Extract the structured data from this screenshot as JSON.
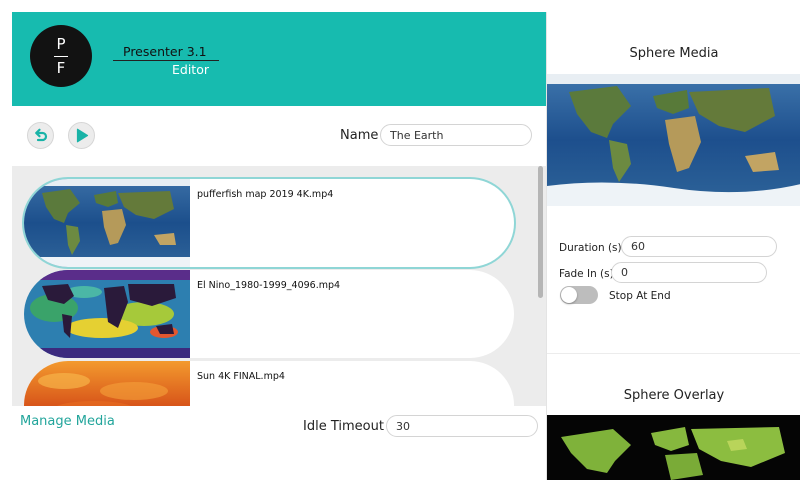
{
  "header": {
    "logo_top": "P",
    "logo_bottom": "F",
    "app_title": "Presenter 3.1",
    "app_subtitle": "Editor",
    "color": "#17bbaf"
  },
  "toolbar": {
    "back_icon": "undo-arrow-icon",
    "play_icon": "play-icon",
    "name_label": "Name",
    "name_value": "The Earth"
  },
  "media_list": {
    "items": [
      {
        "name": "pufferfish map 2019 4K.mp4",
        "thumbnail": "earth-satellite-map",
        "selected": true
      },
      {
        "name": "El Nino_1980-1999_4096.mp4",
        "thumbnail": "el-nino-temperature-map",
        "selected": false
      },
      {
        "name": "Sun 4K FINAL.mp4",
        "thumbnail": "sun-surface",
        "selected": false
      }
    ]
  },
  "footer": {
    "manage_media": "Manage Media",
    "idle_label": "Idle Timeout",
    "idle_value": "30"
  },
  "sphere_media": {
    "title": "Sphere Media",
    "image": "earth-satellite-map",
    "duration_label": "Duration (s)",
    "duration_value": "60",
    "fade_in_label": "Fade In (s)",
    "fade_in_value": "0",
    "stop_at_end_label": "Stop At End",
    "stop_at_end_on": false
  },
  "sphere_overlay": {
    "title": "Sphere Overlay",
    "image": "green-continents-overlay"
  },
  "colors": {
    "accent": "#17bbaf",
    "link": "#22a59b",
    "list_background": "#ececec",
    "selected_outline": "#8fd6d6"
  }
}
